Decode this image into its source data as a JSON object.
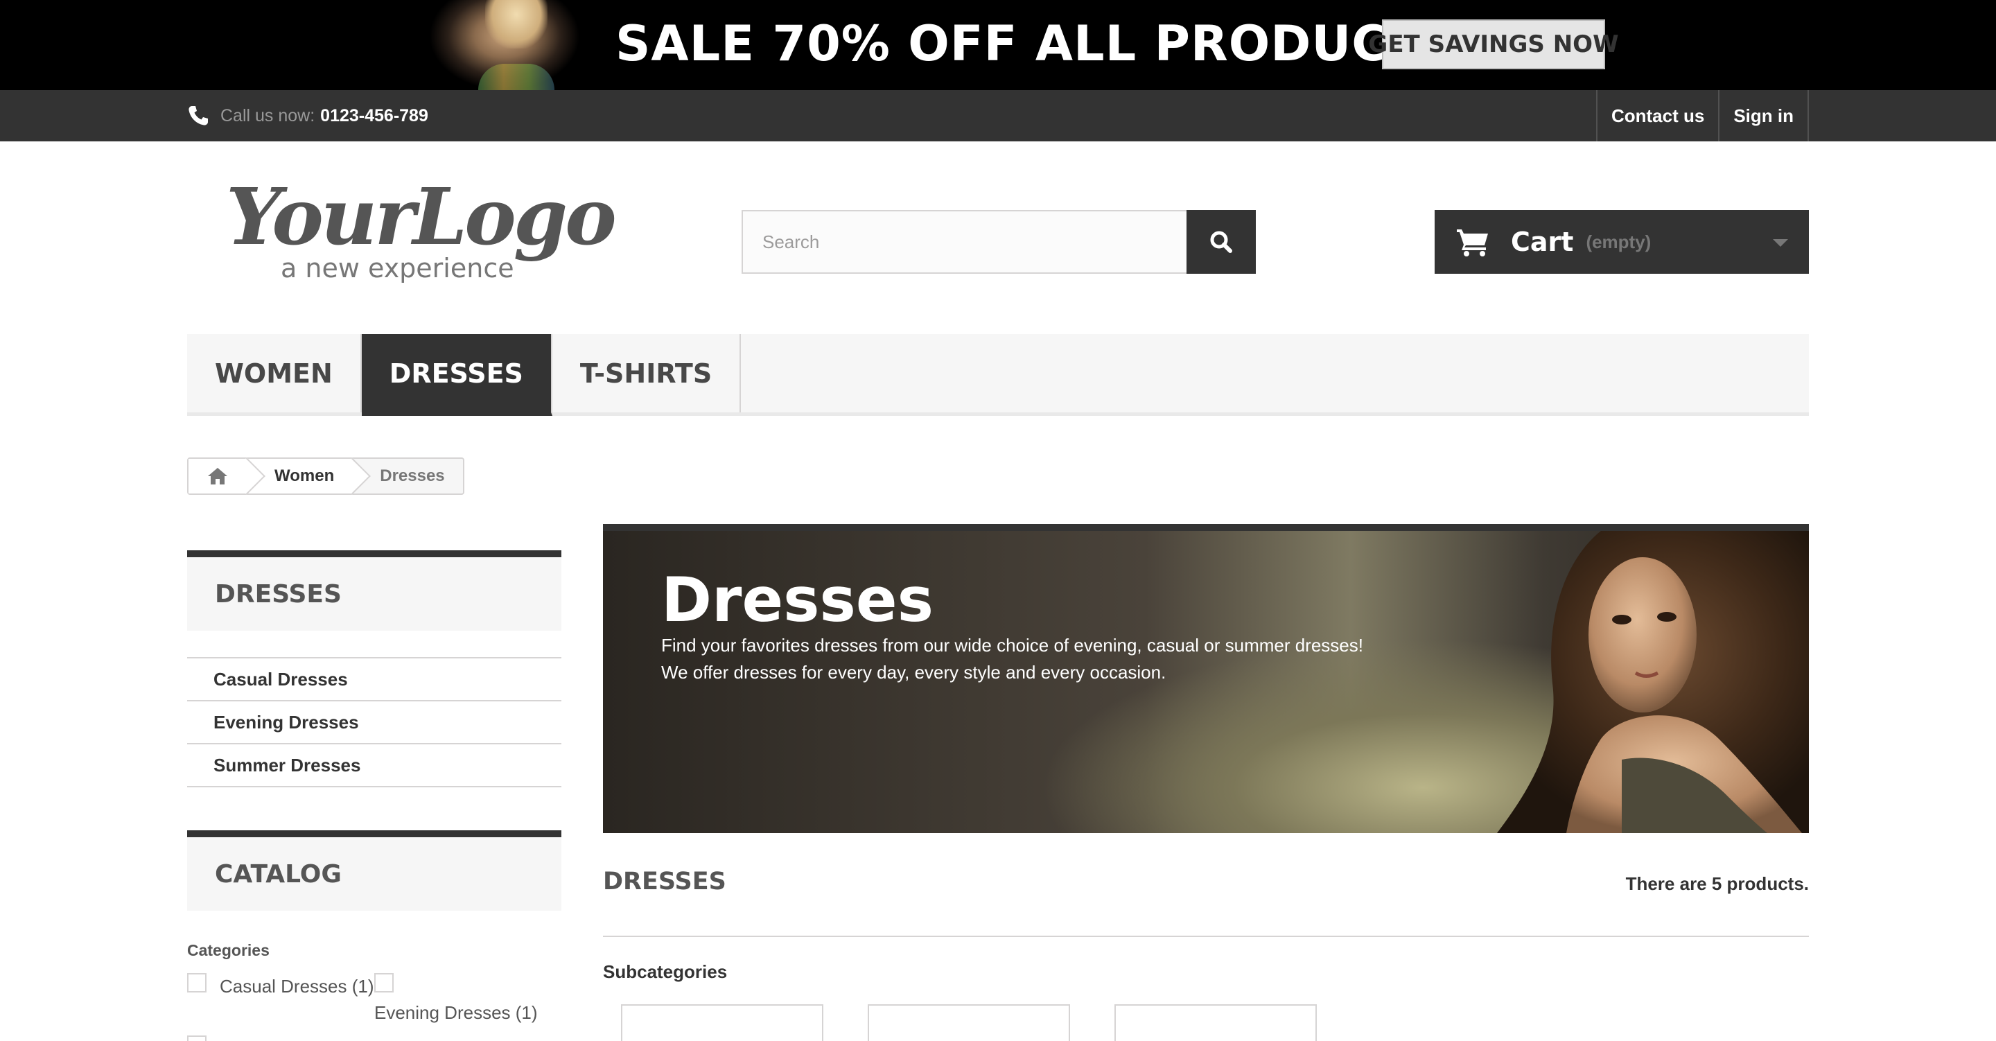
{
  "promo": {
    "text": "SALE 70% OFF ALL PRODUCTS",
    "button": "GET SAVINGS NOW"
  },
  "topbar": {
    "call_label": "Call us now:",
    "phone": "0123-456-789",
    "links": [
      "Contact us",
      "Sign in"
    ]
  },
  "header": {
    "logo_main": "YourLogo",
    "logo_tagline": "a new experience",
    "search_placeholder": "Search",
    "cart_label": "Cart",
    "cart_status": "(empty)"
  },
  "menu": {
    "items": [
      "WOMEN",
      "DRESSES",
      "T-SHIRTS"
    ],
    "active": "DRESSES"
  },
  "breadcrumb": {
    "items": [
      "Women",
      "Dresses"
    ]
  },
  "sidebar": {
    "category_title": "DRESSES",
    "subcategories": [
      "Casual Dresses",
      "Evening Dresses",
      "Summer Dresses"
    ],
    "catalog_title": "CATALOG",
    "filter_heading": "Categories",
    "filters": [
      "Casual Dresses (1)",
      "Evening Dresses (1)"
    ]
  },
  "category": {
    "title": "Dresses",
    "description_line1": "Find your favorites dresses from our wide choice of evening, casual or summer dresses!",
    "description_line2": "We offer dresses for every day, every style and every occasion.",
    "heading": "DRESSES",
    "product_count": "There are 5 products.",
    "subcategories_label": "Subcategories"
  },
  "colors": {
    "dark": "#333333",
    "light_panel": "#f6f6f6",
    "border": "#d6d4d4"
  }
}
